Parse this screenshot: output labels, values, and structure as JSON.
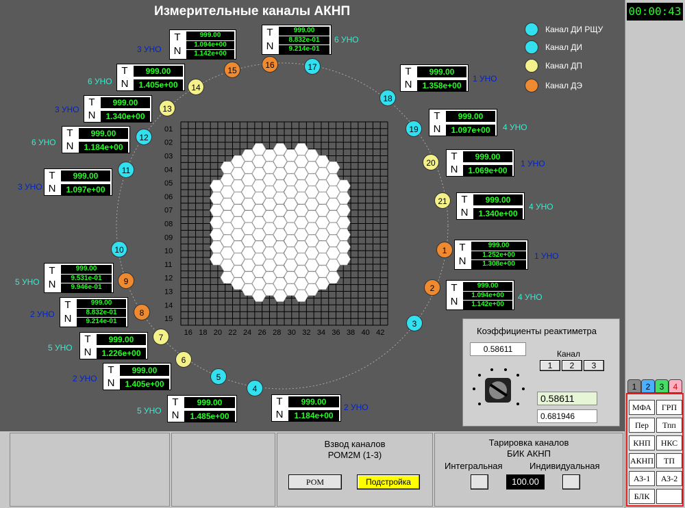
{
  "title": "Измерительные каналы АКНП",
  "timer": "00:00:43",
  "legend": [
    {
      "label": "Канал ДИ РЩУ",
      "color": "#33e0f0"
    },
    {
      "label": "Канал ДИ",
      "color": "#33e0f0"
    },
    {
      "label": "Канал ДП",
      "color": "#f4f08a"
    },
    {
      "label": "Канал ДЭ",
      "color": "#f08a30"
    }
  ],
  "channels": [
    {
      "n": "1",
      "type": "de"
    },
    {
      "n": "2",
      "type": "de"
    },
    {
      "n": "3",
      "type": "di"
    },
    {
      "n": "4",
      "type": "di"
    },
    {
      "n": "5",
      "type": "di"
    },
    {
      "n": "6",
      "type": "dp"
    },
    {
      "n": "7",
      "type": "dp"
    },
    {
      "n": "8",
      "type": "de"
    },
    {
      "n": "9",
      "type": "de"
    },
    {
      "n": "10",
      "type": "di"
    },
    {
      "n": "11",
      "type": "di"
    },
    {
      "n": "12",
      "type": "di"
    },
    {
      "n": "13",
      "type": "dp"
    },
    {
      "n": "14",
      "type": "dp"
    },
    {
      "n": "15",
      "type": "de"
    },
    {
      "n": "16",
      "type": "de"
    },
    {
      "n": "17",
      "type": "di"
    },
    {
      "n": "18",
      "type": "di"
    },
    {
      "n": "19",
      "type": "di"
    },
    {
      "n": "20",
      "type": "dp"
    },
    {
      "n": "21",
      "type": "dp"
    }
  ],
  "tn_boxes": [
    {
      "t": "999.00",
      "n": "1.094e+00",
      "n2": "1.142e+00",
      "uno": "3 УНО",
      "unoColor": "blue"
    },
    {
      "t": "999.00",
      "n": "8.832e-01",
      "n2": "9.214e-01",
      "uno": "6 УНО",
      "unoColor": "cyan"
    },
    {
      "t": "999.00",
      "n": "1.405e+00",
      "uno": "6 УНО",
      "unoColor": "cyan"
    },
    {
      "t": "999.00",
      "n": "1.358e+00",
      "uno": "1 УНО",
      "unoColor": "blue"
    },
    {
      "t": "999.00",
      "n": "1.340e+00",
      "uno": "3 УНО",
      "unoColor": "blue"
    },
    {
      "t": "999.00",
      "n": "1.097e+00",
      "uno": "4 УНО",
      "unoColor": "cyan"
    },
    {
      "t": "999.00",
      "n": "1.184e+00",
      "uno": "6 УНО",
      "unoColor": "cyan"
    },
    {
      "t": "999.00",
      "n": "1.069e+00",
      "uno": "1 УНО",
      "unoColor": "blue"
    },
    {
      "t": "999.00",
      "n": "1.097e+00",
      "uno": "3 УНО",
      "unoColor": "blue"
    },
    {
      "t": "999.00",
      "n": "1.340e+00",
      "uno": "4 УНО",
      "unoColor": "cyan"
    },
    {
      "t": "999.00",
      "n": "1.252e+00",
      "n2": "1.308e+00",
      "uno": "1 УНО",
      "unoColor": "blue"
    },
    {
      "t": "999.00",
      "n": "9.531e-01",
      "n2": "9.946e-01",
      "uno": "5 УНО",
      "unoColor": "cyan"
    },
    {
      "t": "999.00",
      "n": "1.094e+00",
      "n2": "1.142e+00",
      "uno": "4 УНО",
      "unoColor": "cyan"
    },
    {
      "t": "999.00",
      "n": "8.832e-01",
      "n2": "9.214e-01",
      "uno": "2 УНО",
      "unoColor": "blue"
    },
    {
      "t": "999.00",
      "n": "1.226e+00",
      "uno": "5 УНО",
      "unoColor": "cyan"
    },
    {
      "t": "999.00",
      "n": "1.405e+00",
      "uno": "2 УНО",
      "unoColor": "blue"
    },
    {
      "t": "999.00",
      "n": "1.485e+00",
      "uno": "5 УНО",
      "unoColor": "cyan"
    },
    {
      "t": "999.00",
      "n": "1.184e+00",
      "uno": "2 УНО",
      "unoColor": "blue"
    }
  ],
  "grid_rows": [
    "01",
    "02",
    "03",
    "04",
    "05",
    "06",
    "07",
    "08",
    "09",
    "10",
    "11",
    "12",
    "13",
    "14",
    "15"
  ],
  "grid_cols": [
    "16",
    "18",
    "20",
    "22",
    "24",
    "26",
    "28",
    "30",
    "32",
    "34",
    "36",
    "38",
    "40",
    "42"
  ],
  "coef": {
    "title": "Коэффициенты реактиметра",
    "value1": "0.58611",
    "channel_label": "Канал",
    "channel_buttons": [
      "1",
      "2",
      "3"
    ],
    "value2": "0.58611",
    "value3": "0.681946"
  },
  "bottom": {
    "vzvod_title": "Взвод каналов",
    "vzvod_sub": "РОМ2М (1-3)",
    "rom_button": "РОМ",
    "tune_button": "Подстройка",
    "tar_title": "Тарировка каналов",
    "tar_sub": "БИК АКНП",
    "integral": "Интегральная",
    "individual": "Индивидуальная",
    "tar_value": "100.00"
  },
  "tabs": [
    "1",
    "2",
    "3",
    "4"
  ],
  "keys": [
    "МФА",
    "ГРП",
    "Пер",
    "Тпп",
    "КНП",
    "НКС",
    "АКНП",
    "ТП",
    "АЗ-1",
    "АЗ-2",
    "БЛК",
    ""
  ]
}
